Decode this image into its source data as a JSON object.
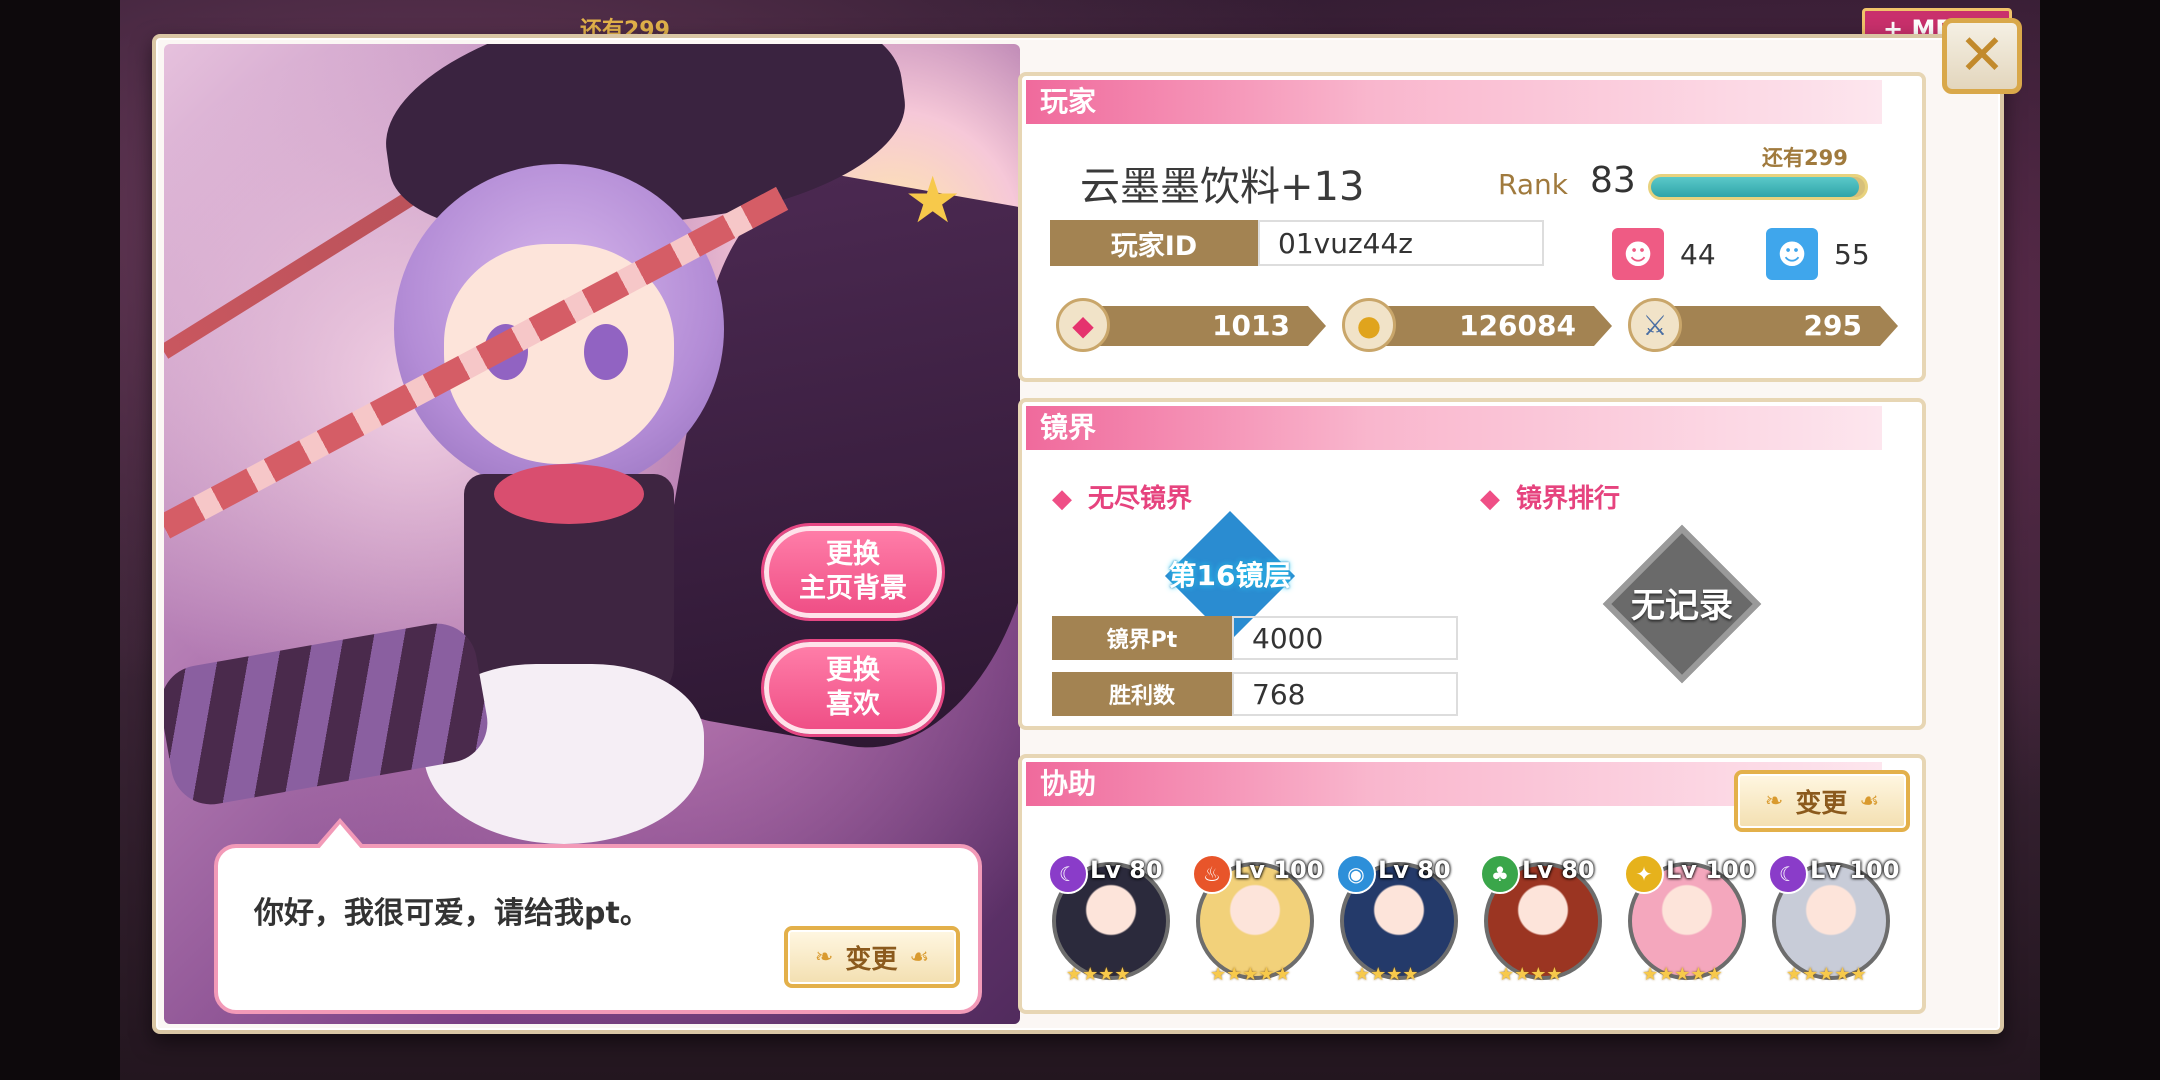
{
  "background": {
    "remain_text": "还有299",
    "badge_text": "+ ME"
  },
  "left": {
    "change_bg_label_1": "更换",
    "change_bg_label_2": "主页背景",
    "change_fav_label_1": "更换",
    "change_fav_label_2": "喜欢",
    "speech": "你好，我很可爱，请给我pt。",
    "speech_change": "变更"
  },
  "player": {
    "header": "玩家",
    "name": "云墨墨饮料+13",
    "rank_label": "Rank",
    "rank": "83",
    "remain": "还有299",
    "exp_fraction": 0.97,
    "id_label": "玩家ID",
    "id": "01vuz44z",
    "stat_pink": "44",
    "stat_blue": "55",
    "gems": "1013",
    "coins": "126084",
    "points": "295"
  },
  "mirror": {
    "header": "镜界",
    "endless_label": "无尽镜界",
    "ranking_label": "镜界排行",
    "floor_badge": "第16镜层",
    "no_record": "无记录",
    "pt_label": "镜界Pt",
    "pt_value": "4000",
    "wins_label": "胜利数",
    "wins_value": "768"
  },
  "assist": {
    "header": "协助",
    "change": "变更",
    "helpers": [
      {
        "lv": "Lv 80",
        "attr_color": "#8a3cc9",
        "attr_icon": "moon-icon",
        "stars": 4,
        "portrait_color": "#2b2a3c"
      },
      {
        "lv": "Lv 100",
        "attr_color": "#e8552a",
        "attr_icon": "fire-icon",
        "stars": 5,
        "portrait_color": "#f2d17a"
      },
      {
        "lv": "Lv 80",
        "attr_color": "#2d8fd9",
        "attr_icon": "water-icon",
        "stars": 4,
        "portrait_color": "#243a6a"
      },
      {
        "lv": "Lv 80",
        "attr_color": "#3aa64a",
        "attr_icon": "leaf-icon",
        "stars": 4,
        "portrait_color": "#9b3522"
      },
      {
        "lv": "Lv 100",
        "attr_color": "#e6b21c",
        "attr_icon": "light-icon",
        "stars": 5,
        "portrait_color": "#f4a7bd"
      },
      {
        "lv": "Lv 100",
        "attr_color": "#8a3cc9",
        "attr_icon": "moon-icon",
        "stars": 5,
        "portrait_color": "#c8ccd8"
      }
    ]
  }
}
